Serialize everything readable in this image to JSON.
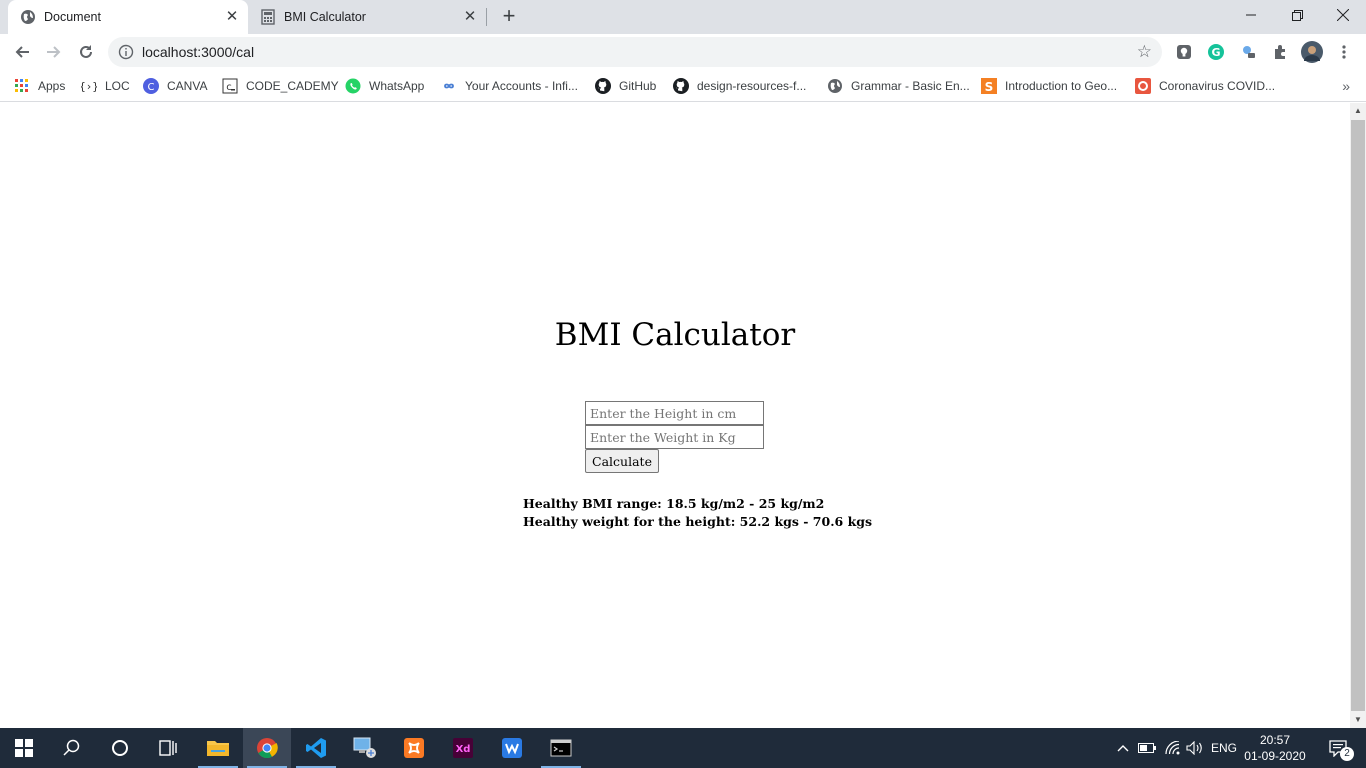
{
  "browser": {
    "tabs": [
      {
        "title": "Document",
        "active": true
      },
      {
        "title": "BMI Calculator",
        "active": false
      }
    ],
    "url": "localhost:3000/cal",
    "bookmarks": [
      {
        "label": "Apps",
        "icon": "apps-grid-icon"
      },
      {
        "label": "LOC",
        "icon": "loc-icon"
      },
      {
        "label": "CANVA",
        "icon": "canva-icon"
      },
      {
        "label": "CODE_CADEMY",
        "icon": "codecademy-icon"
      },
      {
        "label": "WhatsApp",
        "icon": "whatsapp-icon"
      },
      {
        "label": "Your Accounts - Infi...",
        "icon": "infinity-icon"
      },
      {
        "label": "GitHub",
        "icon": "github-icon"
      },
      {
        "label": "design-resources-f...",
        "icon": "github-icon"
      },
      {
        "label": "Grammar - Basic En...",
        "icon": "globe-icon"
      },
      {
        "label": "Introduction to Geo...",
        "icon": "sololearn-icon"
      },
      {
        "label": "Coronavirus COVID...",
        "icon": "covid-icon"
      }
    ]
  },
  "page": {
    "title": "BMI Calculator",
    "height_placeholder": "Enter the Height in cm",
    "weight_placeholder": "Enter the Weight in Kg",
    "button_label": "Calculate",
    "result_range": "Healthy BMI range: 18.5 kg/m2 - 25 kg/m2",
    "result_weight": "Healthy weight for the height: 52.2 kgs - 70.6 kgs"
  },
  "taskbar": {
    "language": "ENG",
    "time": "20:57",
    "date": "01-09-2020",
    "notifications": "2"
  }
}
